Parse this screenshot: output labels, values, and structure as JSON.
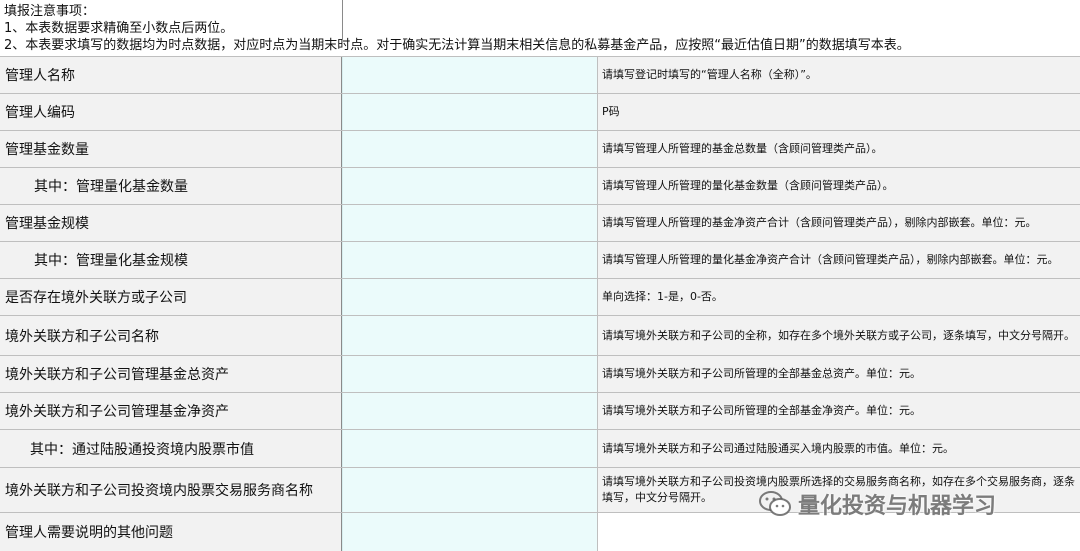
{
  "notes": {
    "title": "填报注意事项：",
    "line1": "1、本表数据要求精确至小数点后两位。",
    "line2": "2、本表要求填写的数据均为时点数据，对应时点为当期末时点。对于确实无法计算当期末相关信息的私募基金产品，应按照“最近估值日期”的数据填写本表。"
  },
  "rows": [
    {
      "label": "管理人名称",
      "value": "",
      "hint": "请填写登记时填写的“管理人名称（全称）”。"
    },
    {
      "label": "管理人编码",
      "value": "",
      "hint": "P码"
    },
    {
      "label": "管理基金数量",
      "value": "",
      "hint": "请填写管理人所管理的基金总数量（含顾问管理类产品）。"
    },
    {
      "label": "其中：管理量化基金数量",
      "value": "",
      "hint": "请填写管理人所管理的量化基金数量（含顾问管理类产品）。"
    },
    {
      "label": "管理基金规模",
      "value": "",
      "hint": "请填写管理人所管理的基金净资产合计（含顾问管理类产品），剔除内部嵌套。单位：元。"
    },
    {
      "label": "其中：管理量化基金规模",
      "value": "",
      "hint": "请填写管理人所管理的量化基金净资产合计（含顾问管理类产品），剔除内部嵌套。单位：元。"
    },
    {
      "label": "是否存在境外关联方或子公司",
      "value": "",
      "hint": "单向选择：1-是，0-否。"
    },
    {
      "label": "境外关联方和子公司名称",
      "value": "",
      "hint": "请填写境外关联方和子公司的全称，如存在多个境外关联方或子公司，逐条填写，中文分号隔开。"
    },
    {
      "label": "境外关联方和子公司管理基金总资产",
      "value": "",
      "hint": "请填写境外关联方和子公司所管理的全部基金总资产。单位：元。"
    },
    {
      "label": "境外关联方和子公司管理基金净资产",
      "value": "",
      "hint": "请填写境外关联方和子公司所管理的全部基金净资产。单位：元。"
    },
    {
      "label": "其中：通过陆股通投资境内股票市值",
      "value": "",
      "hint": "请填写境外关联方和子公司通过陆股通买入境内股票的市值。单位：元。"
    },
    {
      "label": "境外关联方和子公司投资境内股票交易服务商名称",
      "value": "",
      "hint": "请填写境外关联方和子公司投资境内股票所选择的交易服务商名称，如存在多个交易服务商，逐条填写，中文分号隔开。"
    },
    {
      "label": "管理人需要说明的其他问题",
      "value": "",
      "hint": ""
    }
  ],
  "watermark": {
    "text": "量化投资与机器学习",
    "icon": "wechat-icon"
  },
  "colors": {
    "label_bg": "#f2f2f2",
    "input_bg": "#ebfbfb",
    "grid_line": "#bfbfbf"
  }
}
